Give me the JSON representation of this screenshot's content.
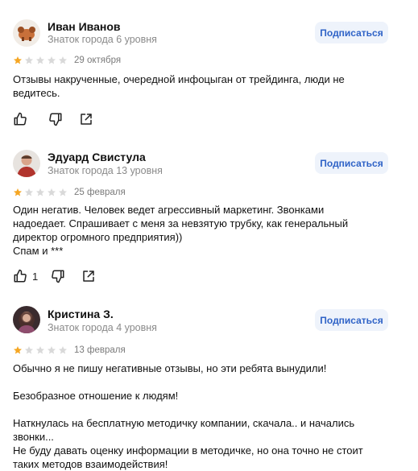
{
  "subscribe_label": "Подписаться",
  "reviews": [
    {
      "name": "Иван Иванов",
      "rank": "Знаток города 6 уровня",
      "rating": 1,
      "date": "29 октября",
      "text": "Отзывы накрученные, очередной инфоцыган от трейдинга, люди не\nведитесь.",
      "likes": ""
    },
    {
      "name": "Эдуард Свистула",
      "rank": "Знаток города 13 уровня",
      "rating": 1,
      "date": "25 февраля",
      "text": "Один негатив. Человек ведет агрессивный маркетинг. Звонками\nнадоедает. Спрашивает с меня за невзятую трубку, как генеральный\nдиректор огромного предприятия))\nСпам и ***",
      "likes": "1"
    },
    {
      "name": "Кристина З.",
      "rank": "Знаток города 4 уровня",
      "rating": 1,
      "date": "13 февраля",
      "text": "Обычно я не пишу негативные отзывы, но эти ребята вынудили!\n\nБезобразное отношение к людям!\n\nНаткнулась на бесплатную методичку компании, скачала.. и начались\nзвонки...\nНе буду давать оценку информации в методичке, но она точно не стоит\nтаких методов взаимодействия!",
      "likes": ""
    }
  ],
  "colors": {
    "star_filled": "#f5a623",
    "star_empty": "#d9d9d9",
    "subscribe_bg": "#eef3fb",
    "subscribe_text": "#2f63c7"
  },
  "icons": [
    "like-icon",
    "dislike-icon",
    "share-icon",
    "star-icon"
  ]
}
